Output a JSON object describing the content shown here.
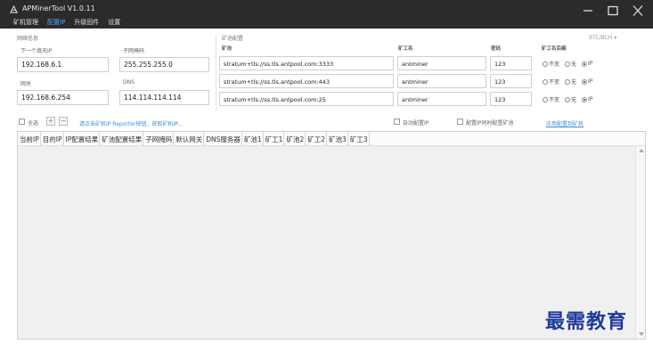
{
  "window": {
    "title": "APMinerTool V1.0.11"
  },
  "menu": [
    {
      "label": "矿机管理",
      "active": false
    },
    {
      "label": "配置IP",
      "active": true
    },
    {
      "label": "升级固件",
      "active": false
    },
    {
      "label": "设置",
      "active": false
    }
  ],
  "network": {
    "section_label": "网络信息",
    "next_ip_label": "下一个填充IP",
    "next_ip_value": "192.168.6.1",
    "subnet_label": "子网掩码",
    "subnet_value": "255.255.255.0",
    "gateway_label": "网关",
    "gateway_value": "192.168.6.254",
    "dns_label": "DNS",
    "dns_value": "114.114.114.114"
  },
  "pool": {
    "section_label": "矿池配置",
    "coin_select": "BTC/BCH",
    "headers": {
      "pool": "矿池",
      "worker": "矿工名",
      "password": "密码",
      "suffix": "矿工名后缀"
    },
    "rows": [
      {
        "pool": "stratum+tls://ss.tls.antpool.com:3333",
        "worker": "antminer",
        "password": "123",
        "suffix": "IP"
      },
      {
        "pool": "stratum+tls://ss.tls.antpool.com:443",
        "worker": "antminer",
        "password": "123",
        "suffix": "IP"
      },
      {
        "pool": "stratum+tls://ss.tls.antpool.com:25",
        "worker": "antminer",
        "password": "123",
        "suffix": "IP"
      }
    ],
    "suffix_options": [
      "不变",
      "无",
      "IP"
    ]
  },
  "toolbar": {
    "select_all": "全选",
    "hint": "请点击矿机IP Reporter按钮，获取矿机IP...",
    "auto_ip": "自动配置IP",
    "sync_pool": "配置IP同时配置矿池",
    "apply": "应用配置到矿机"
  },
  "table": {
    "columns": [
      "当前IP",
      "目的IP",
      "IP配置结果",
      "矿池配置结果",
      "子网掩码",
      "默认网关",
      "DNS服务器",
      "矿池1",
      "矿工1",
      "矿池2",
      "矿工2",
      "矿池3",
      "矿工3"
    ]
  },
  "watermark": "最需教育",
  "colors": {
    "titlebar": "#2b2b2b",
    "accent": "#4aa8ff",
    "link": "#3d8ed8"
  }
}
